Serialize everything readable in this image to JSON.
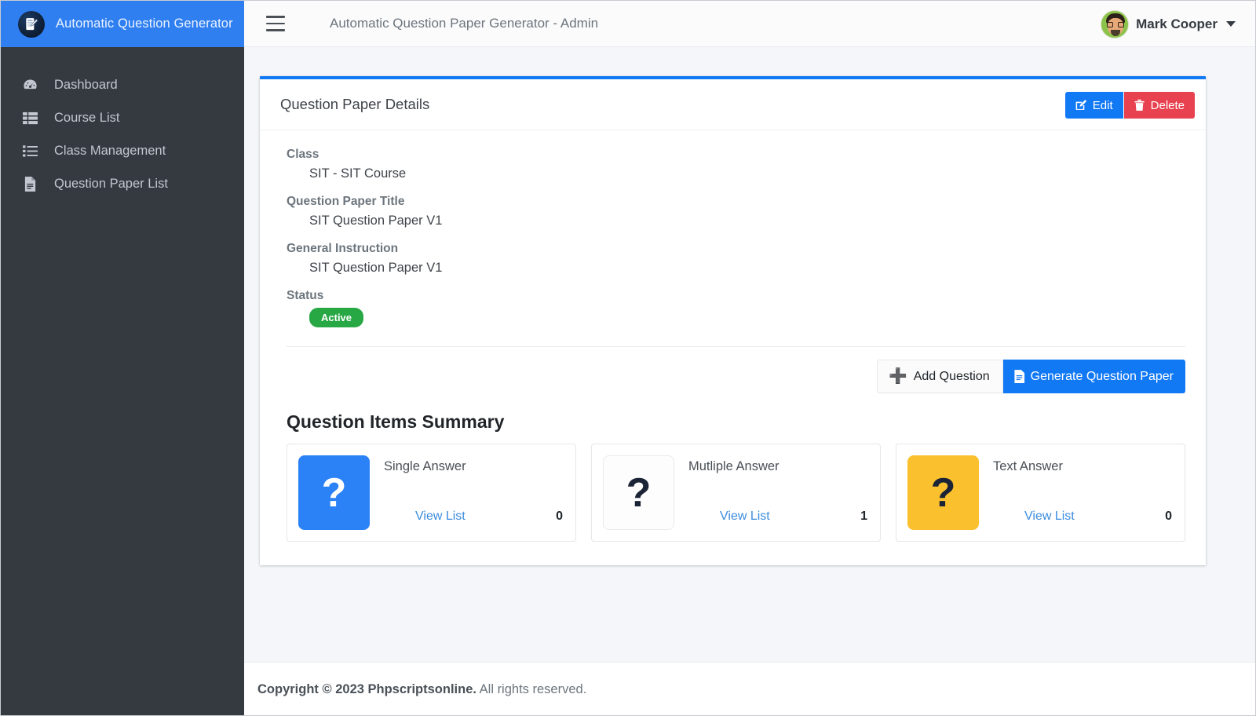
{
  "sidebar": {
    "brand": {
      "title": "Automatic Question Generator",
      "logo_icon": "document-pencil-icon",
      "background_color": "#2f7ff0"
    },
    "items": [
      {
        "label": "Dashboard",
        "icon": "tachometer-icon"
      },
      {
        "label": "Course List",
        "icon": "th-list-icon"
      },
      {
        "label": "Class Management",
        "icon": "list-ul-icon"
      },
      {
        "label": "Question Paper List",
        "icon": "file-alt-icon"
      }
    ],
    "background_color": "#343a40"
  },
  "header": {
    "menu_toggle_icon": "hamburger-icon",
    "title": "Automatic Question Paper Generator - Admin",
    "user": {
      "name": "Mark Cooper",
      "avatar_icon": "user-avatar",
      "caret_icon": "caret-down-icon"
    }
  },
  "card": {
    "title": "Question Paper Details",
    "accent_color": "#1279f5",
    "tools": {
      "edit_label": "Edit",
      "edit_icon": "pencil-square-icon",
      "edit_color": "#1279f5",
      "delete_label": "Delete",
      "delete_icon": "trash-icon",
      "delete_color": "#e8414f"
    },
    "fields": [
      {
        "label": "Class",
        "value": "SIT - SIT Course"
      },
      {
        "label": "Question Paper Title",
        "value": "SIT Question Paper V1"
      },
      {
        "label": "General Instruction",
        "value": "SIT Question Paper V1"
      }
    ],
    "status": {
      "label": "Status",
      "badge_text": "Active",
      "badge_color": "#28a745"
    },
    "actions": {
      "add_question_label": "Add Question",
      "add_question_icon": "plus-icon",
      "generate_label": "Generate Question Paper",
      "generate_icon": "file-icon",
      "generate_color": "#1279f5"
    }
  },
  "summary": {
    "title": "Question Items Summary",
    "cards": [
      {
        "label": "Single Answer",
        "count": "0",
        "link_label": "View List",
        "icon": "question-mark-icon",
        "icon_bg": "#2b82f6",
        "icon_fg": "#ffffff"
      },
      {
        "label": "Mutliple Answer",
        "count": "1",
        "link_label": "View List",
        "icon": "question-mark-icon",
        "icon_bg": "#fdfdfe",
        "icon_fg": "#1b2436"
      },
      {
        "label": "Text Answer",
        "count": "0",
        "link_label": "View List",
        "icon": "question-mark-icon",
        "icon_bg": "#fbc02d",
        "icon_fg": "#1b2436"
      }
    ]
  },
  "footer": {
    "copyright_bold": "Copyright © 2023 Phpscriptsonline.",
    "copyright_rest": " All rights reserved."
  }
}
